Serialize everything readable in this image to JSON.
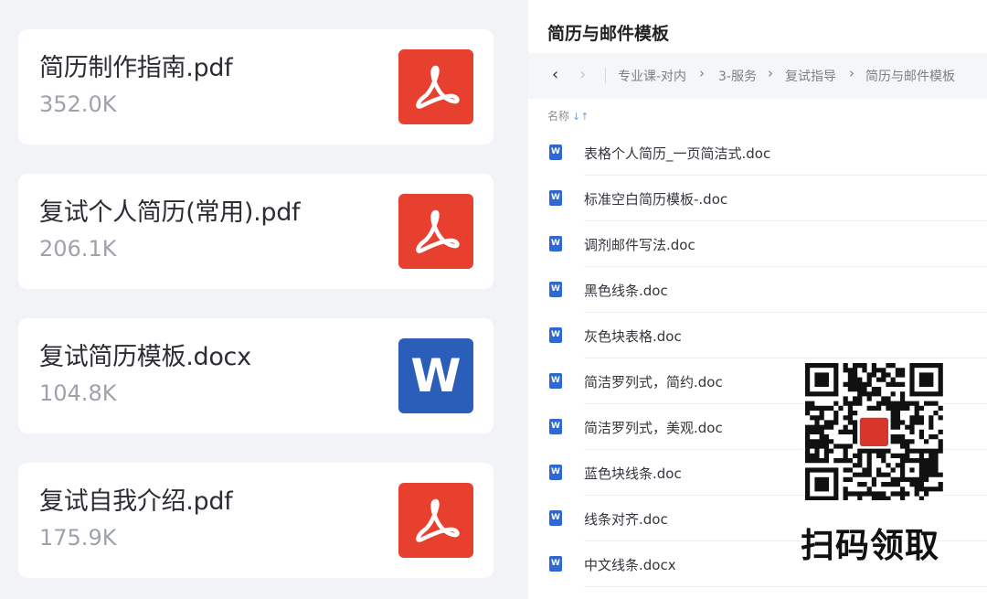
{
  "files": [
    {
      "name": "简历制作指南.pdf",
      "size": "352.0K",
      "type": "pdf",
      "icon": "pdf-icon"
    },
    {
      "name": "复试个人简历(常用).pdf",
      "size": "206.1K",
      "type": "pdf",
      "icon": "pdf-icon"
    },
    {
      "name": "复试简历模板.docx",
      "size": "104.8K",
      "type": "word",
      "icon": "word-icon",
      "icon_letter": "W"
    },
    {
      "name": "复试自我介绍.pdf",
      "size": "175.9K",
      "type": "pdf",
      "icon": "pdf-icon"
    }
  ],
  "panel": {
    "title": "简历与邮件模板",
    "breadcrumb": [
      "专业课-对内",
      "3-服务",
      "复试指导",
      "简历与邮件模板"
    ],
    "column_header": "名称",
    "items": [
      {
        "name": "表格个人简历_一页简洁式.doc"
      },
      {
        "name": "标准空白简历模板-.doc"
      },
      {
        "name": "调剂邮件写法.doc"
      },
      {
        "name": "黑色线条.doc"
      },
      {
        "name": "灰色块表格.doc"
      },
      {
        "name": "简洁罗列式，简约.doc"
      },
      {
        "name": "简洁罗列式，美观.doc"
      },
      {
        "name": "蓝色块线条.doc"
      },
      {
        "name": "线条对齐.doc"
      },
      {
        "name": "中文线条.docx"
      }
    ]
  },
  "overlay": {
    "qr_label": "扫码领取"
  },
  "colors": {
    "pdf_red": "#e8402f",
    "word_blue": "#2a5eb8",
    "doc_icon_blue": "#2e68d0",
    "left_bg": "#f2f3f7"
  }
}
